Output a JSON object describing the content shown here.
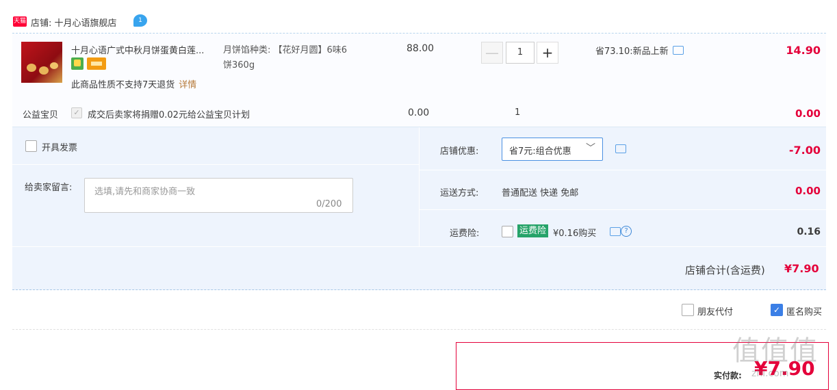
{
  "shop": {
    "logo_text": "天猫",
    "label": "店铺: 十月心语旗舰店",
    "chat_badge": "1"
  },
  "item": {
    "title": "十月心语广式中秋月饼蛋黄白莲...",
    "sku_line1": "月饼馅种类: 【花好月圆】6味6",
    "sku_line2": "饼360g",
    "unit_price": "88.00",
    "quantity": "1",
    "qty_minus": "—",
    "qty_plus": "+",
    "promo": "省73.10:新品上新",
    "subtotal": "14.90",
    "no_return": "此商品性质不支持7天退货",
    "detail_link": "详情"
  },
  "charity": {
    "label": "公益宝贝",
    "check_mark": "✓",
    "text": "成交后卖家将捐赠0.02元给公益宝贝计划",
    "price": "0.00",
    "qty": "1",
    "subtotal": "0.00"
  },
  "options": {
    "invoice_label": "开具发票",
    "message_label": "给卖家留言:",
    "message_placeholder": "选填,请先和商家协商一致",
    "message_count": "0/200",
    "discount_label": "店铺优惠:",
    "discount_value": "省7元:组合优惠",
    "discount_chevron": "﹀",
    "discount_amount": "-7.00",
    "shipping_label": "运送方式:",
    "shipping_value": "普通配送 快递 免邮",
    "shipping_amount": "0.00",
    "insurance_label": "运费险:",
    "insurance_tag": "运费险",
    "insurance_text": "¥0.16购买",
    "insurance_help": "?",
    "insurance_amount": "0.16",
    "total_label": "店铺合计(含运费)",
    "total_amount": "¥7.90"
  },
  "bottom": {
    "friend_pay_label": "朋友代付",
    "anonymous_label": "匿名购买",
    "anonymous_check": "✓",
    "pay_label": "实付款:",
    "pay_amount": "¥7.90",
    "watermark": "值值值",
    "watermark_sub": "zhi.com"
  },
  "colors": {
    "accent_red": "#e4003a",
    "panel_blue": "#eef4fd",
    "checkbox_blue": "#3b7fe6",
    "insurance_green": "#26a369"
  }
}
